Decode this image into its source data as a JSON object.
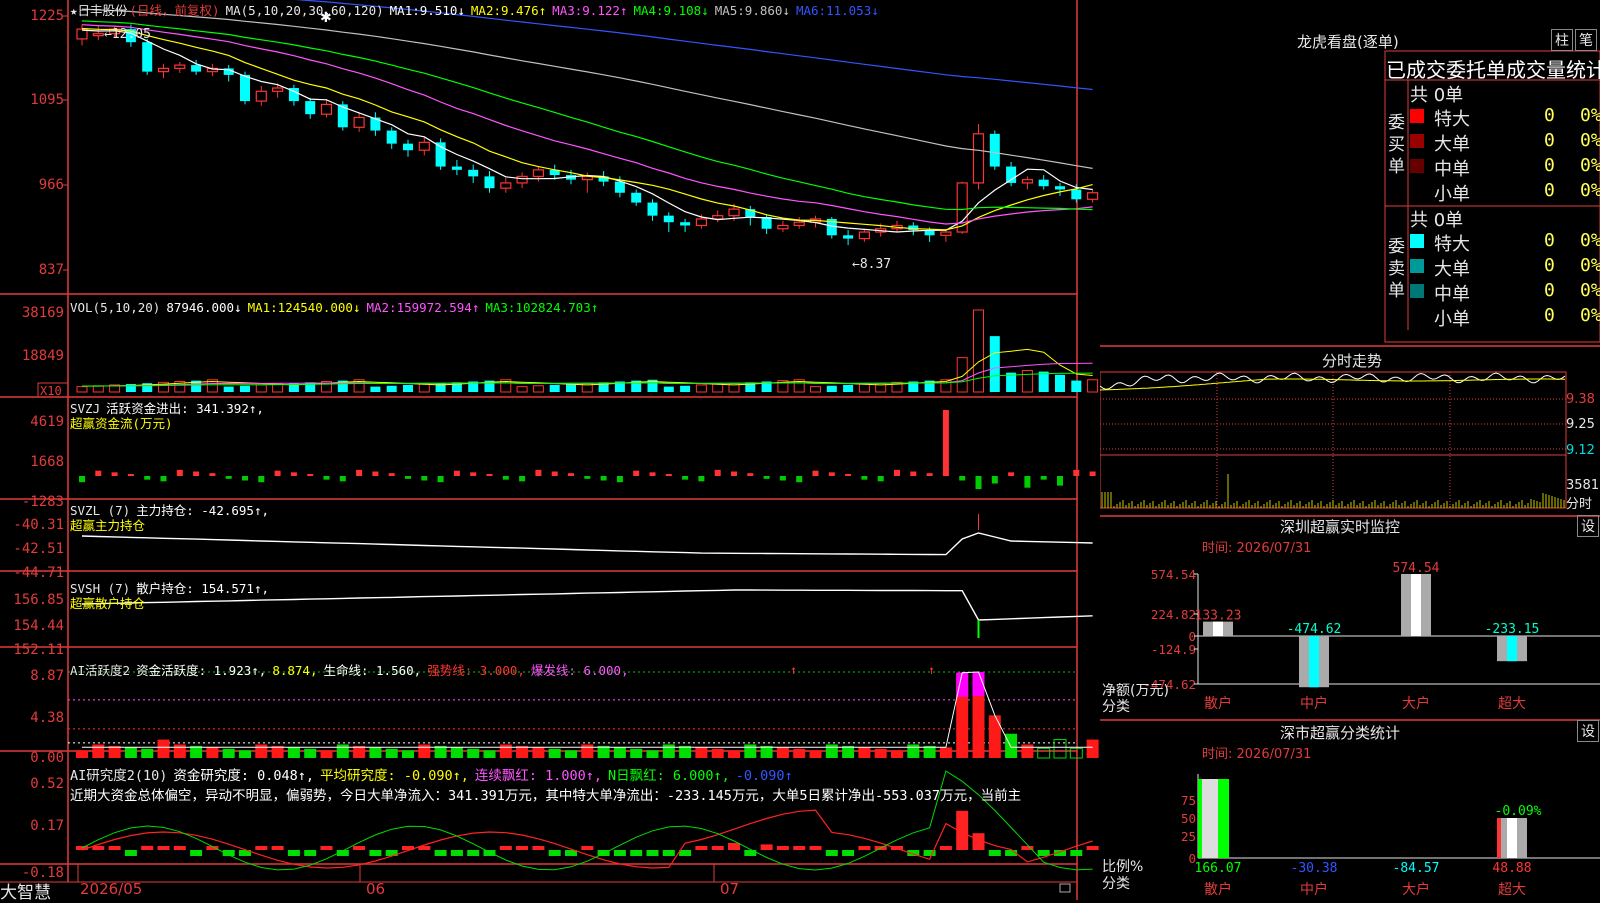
{
  "main": {
    "stock_name": "★日丰股份",
    "stock_type": "(日线，前复权)",
    "ma_params": "MA(5,10,20,30,60,120)",
    "ma": [
      {
        "label": "MA1:",
        "value": "9.510↓",
        "color": "#ffffff"
      },
      {
        "label": "MA2:",
        "value": "9.476↑",
        "color": "#ffff00"
      },
      {
        "label": "MA3:",
        "value": "9.122↑",
        "color": "#ff55ff"
      },
      {
        "label": "MA4:",
        "value": "9.108↓",
        "color": "#00ff00"
      },
      {
        "label": "MA5:",
        "value": "9.860↓",
        "color": "#c0c0c0"
      },
      {
        "label": "MA6:",
        "value": "11.053↓",
        "color": "#3355ff"
      }
    ],
    "y_ticks": [
      "1225",
      "1095",
      "966",
      "837"
    ],
    "high_label": "←12.05",
    "low_label": "←8.37"
  },
  "vol": {
    "title": "VOL(5,10,20)",
    "items": [
      {
        "label": "",
        "value": "87946.000↓",
        "color": "#ffffff"
      },
      {
        "label": "MA1:",
        "value": "124540.000↓",
        "color": "#ffff00"
      },
      {
        "label": "MA2:",
        "value": "159972.594↑",
        "color": "#ff55ff"
      },
      {
        "label": "MA3:",
        "value": "102824.703↑",
        "color": "#00ff00"
      }
    ],
    "y_ticks": [
      "38169",
      "18849"
    ],
    "unit": "X10"
  },
  "svzj": {
    "title": "SVZJ",
    "line1": "活跃资金进出: 341.392↑,",
    "line2": "超赢资金流(万元)",
    "y_ticks": [
      "4619",
      "1668",
      "-1283"
    ]
  },
  "svzl": {
    "title": "SVZL (7)",
    "line1": "主力持仓: -42.695↑,",
    "line2": "超赢主力持仓",
    "y_ticks": [
      "-40.31",
      "-42.51",
      "-44.71"
    ]
  },
  "svsh": {
    "title": "SVSH (7)",
    "line1": "散户持仓: 154.571↑,",
    "line2": "超赢散户持仓",
    "y_ticks": [
      "156.85",
      "154.44",
      "152.11"
    ]
  },
  "ai_active": {
    "title": "AI活跃度2",
    "items": [
      {
        "text": "资金活跃度: 1.923↑,",
        "color": "#ffffff"
      },
      {
        "text": "8.874,",
        "color": "#ffff00"
      },
      {
        "text": "生命线: 1.560,",
        "color": "#ffffff"
      },
      {
        "text": "强势线: 3.000,",
        "color": "#ff3333"
      },
      {
        "text": "爆发线: 6.000,",
        "color": "#ff55ff"
      }
    ],
    "y_ticks": [
      "8.87",
      "4.38",
      "0.00"
    ]
  },
  "ai_research": {
    "title": "AI研究度2(10)",
    "items": [
      {
        "text": "资金研究度: 0.048↑,",
        "color": "#ffffff"
      },
      {
        "text": "平均研究度: -0.090↑,",
        "color": "#ffff00"
      },
      {
        "text": "连续飘红: 1.000↑,",
        "color": "#ff55ff"
      },
      {
        "text": "N日飘红: 6.000↑,",
        "color": "#00ff00"
      },
      {
        "text": "-0.090↑",
        "color": "#3355ff"
      }
    ],
    "comment": "近期大资金总体偏空，异动不明显，偏弱势，今日大单净流入：341.391万元，其中特大单净流出：-233.145万元，大单5日累计净出-553.037万元，当前主",
    "y_ticks": [
      "0.52",
      "0.17",
      "-0.18"
    ]
  },
  "dates": {
    "brand": "大智慧",
    "labels": [
      "2026/05",
      "06",
      "07"
    ]
  },
  "dragon": {
    "title": "龙虎看盘(逐单)",
    "btn1": "柱",
    "btn2": "笔",
    "header": "已成交委托单成交量统计",
    "buy_label": "委买单",
    "sell_label": "委卖单",
    "buy_total": "共 0单",
    "sell_total": "共 0单",
    "buy_rows": [
      {
        "name": "特大",
        "count": "0",
        "pct": "0%",
        "color": "#ff0000"
      },
      {
        "name": "大单",
        "count": "0",
        "pct": "0%",
        "color": "#990000"
      },
      {
        "name": "中单",
        "count": "0",
        "pct": "0%",
        "color": "#660000"
      },
      {
        "name": "小单",
        "count": "0",
        "pct": "0%",
        "color": "#000000"
      }
    ],
    "sell_rows": [
      {
        "name": "特大",
        "count": "0",
        "pct": "0%",
        "color": "#00ffff"
      },
      {
        "name": "大单",
        "count": "0",
        "pct": "0%",
        "color": "#009999"
      },
      {
        "name": "中单",
        "count": "0",
        "pct": "0%",
        "color": "#007777"
      },
      {
        "name": "小单",
        "count": "0",
        "pct": "0%",
        "color": "#000000"
      }
    ]
  },
  "intraday": {
    "title": "分时走势",
    "y_ticks": [
      "9.38",
      "9.25",
      "9.12"
    ],
    "vol_tick": "3581",
    "vol_unit": "分时"
  },
  "sz_monitor": {
    "title": "深圳超赢实时监控",
    "btn": "设",
    "time": "时间: 2026/07/31",
    "y_ticks": [
      "574.54",
      "224.82",
      "0",
      "-124.9",
      "-474.62"
    ],
    "y_title": "净额(万元)",
    "x_title": "分类",
    "bars": [
      {
        "name": "散户",
        "value": "133.23",
        "v": 133.23
      },
      {
        "name": "中户",
        "value": "-474.62",
        "v": -474.62
      },
      {
        "name": "大户",
        "value": "574.54",
        "v": 574.54
      },
      {
        "name": "超大",
        "value": "-233.15",
        "v": -233.15
      }
    ]
  },
  "sz_class": {
    "title": "深市超赢分类统计",
    "btn": "设",
    "time": "时间: 2026/07/31",
    "y_ticks": [
      "75",
      "50",
      "25",
      "0"
    ],
    "y_title": "比例%",
    "x_title": "分类",
    "bars": [
      {
        "name": "散户",
        "value": "166.07",
        "color": "#00ff00"
      },
      {
        "name": "中户",
        "value": "-30.38",
        "color": "#3355ff"
      },
      {
        "name": "大户",
        "value": "-84.57",
        "color": "#00ffff"
      },
      {
        "name": "超大",
        "value": "48.88",
        "color": "#ff3333"
      }
    ],
    "top_label": "-0.09%"
  },
  "chart_data": [
    {
      "type": "candlestick",
      "title": "日丰股份 (日线，前复权)",
      "yticks": [
        1225,
        1095,
        966,
        837
      ],
      "high": 12.05,
      "low": 8.37,
      "series": [
        {
          "name": "MA1",
          "values": [
            9.51
          ]
        },
        {
          "name": "MA2",
          "values": [
            9.476
          ]
        },
        {
          "name": "MA3",
          "values": [
            9.122
          ]
        },
        {
          "name": "MA4",
          "values": [
            9.108
          ]
        },
        {
          "name": "MA5",
          "values": [
            9.86
          ]
        },
        {
          "name": "MA6",
          "values": [
            11.053
          ]
        }
      ],
      "candles": [
        [
          11.9,
          12.05,
          12.12,
          11.8
        ],
        [
          11.95,
          11.98,
          12.1,
          11.88
        ],
        [
          11.98,
          12.05,
          12.1,
          11.92
        ],
        [
          12.05,
          11.85,
          12.12,
          11.78
        ],
        [
          11.85,
          11.4,
          11.9,
          11.35
        ],
        [
          11.4,
          11.45,
          11.52,
          11.3
        ],
        [
          11.45,
          11.5,
          11.55,
          11.38
        ],
        [
          11.5,
          11.4,
          11.58,
          11.35
        ],
        [
          11.4,
          11.45,
          11.52,
          11.33
        ],
        [
          11.45,
          11.35,
          11.5,
          11.25
        ],
        [
          11.35,
          10.95,
          11.4,
          10.9
        ],
        [
          10.95,
          11.1,
          11.18,
          10.88
        ],
        [
          11.1,
          11.15,
          11.22,
          11.0
        ],
        [
          11.15,
          10.95,
          11.2,
          10.88
        ],
        [
          10.95,
          10.75,
          11.0,
          10.68
        ],
        [
          10.75,
          10.9,
          10.98,
          10.7
        ],
        [
          10.9,
          10.55,
          10.95,
          10.5
        ],
        [
          10.55,
          10.7,
          10.78,
          10.48
        ],
        [
          10.7,
          10.5,
          10.78,
          10.42
        ],
        [
          10.5,
          10.3,
          10.55,
          10.22
        ],
        [
          10.3,
          10.2,
          10.36,
          10.1
        ],
        [
          10.2,
          10.32,
          10.4,
          10.12
        ],
        [
          10.32,
          9.95,
          10.38,
          9.9
        ],
        [
          9.95,
          9.9,
          10.05,
          9.82
        ],
        [
          9.9,
          9.8,
          9.98,
          9.7
        ],
        [
          9.8,
          9.62,
          9.88,
          9.55
        ],
        [
          9.62,
          9.7,
          9.78,
          9.55
        ],
        [
          9.7,
          9.8,
          9.86,
          9.62
        ],
        [
          9.8,
          9.9,
          9.96,
          9.72
        ],
        [
          9.9,
          9.82,
          9.98,
          9.75
        ],
        [
          9.82,
          9.75,
          9.9,
          9.68
        ],
        [
          9.75,
          9.8,
          9.86,
          9.55
        ],
        [
          9.8,
          9.72,
          9.88,
          9.65
        ],
        [
          9.72,
          9.55,
          9.8,
          9.48
        ],
        [
          9.55,
          9.4,
          9.6,
          9.35
        ],
        [
          9.4,
          9.2,
          9.45,
          9.12
        ],
        [
          9.2,
          9.1,
          9.25,
          8.95
        ],
        [
          9.1,
          9.05,
          9.15,
          8.95
        ],
        [
          9.05,
          9.15,
          9.22,
          9.0
        ],
        [
          9.15,
          9.2,
          9.28,
          9.1
        ],
        [
          9.2,
          9.3,
          9.38,
          9.12
        ],
        [
          9.3,
          9.18,
          9.35,
          9.05
        ],
        [
          9.18,
          9.0,
          9.22,
          8.92
        ],
        [
          9.0,
          9.05,
          9.12,
          8.95
        ],
        [
          9.05,
          9.1,
          9.18,
          9.0
        ],
        [
          9.1,
          9.15,
          9.2,
          9.02
        ],
        [
          9.15,
          8.9,
          9.18,
          8.85
        ],
        [
          8.9,
          8.85,
          8.98,
          8.75
        ],
        [
          8.85,
          8.95,
          9.0,
          8.8
        ],
        [
          8.95,
          9.0,
          9.08,
          8.88
        ],
        [
          9.0,
          9.05,
          9.12,
          8.95
        ],
        [
          9.05,
          8.98,
          9.1,
          8.9
        ],
        [
          8.98,
          8.9,
          9.02,
          8.8
        ],
        [
          8.9,
          8.95,
          9.0,
          8.8
        ],
        [
          8.95,
          9.7,
          9.72,
          8.92
        ],
        [
          9.7,
          10.45,
          10.6,
          9.6
        ],
        [
          10.45,
          9.95,
          10.5,
          9.9
        ],
        [
          9.95,
          9.7,
          10.02,
          9.65
        ],
        [
          9.7,
          9.75,
          9.8,
          9.6
        ],
        [
          9.75,
          9.65,
          9.82,
          9.6
        ],
        [
          9.65,
          9.6,
          9.7,
          9.5
        ],
        [
          9.6,
          9.45,
          9.68,
          9.4
        ],
        [
          9.45,
          9.55,
          9.6,
          9.4
        ]
      ]
    }
  ]
}
